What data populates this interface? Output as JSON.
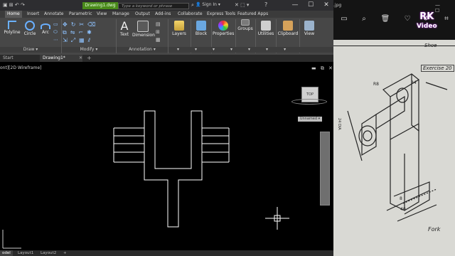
{
  "titlebar": {
    "file_title": "Drawing1.dwg",
    "search_placeholder": "Type a keyword or phrase",
    "sign_in": "Sign In",
    "help": "?",
    "minimize": "—",
    "maximize": "☐",
    "close": "✕"
  },
  "ribbon_tabs": [
    "Home",
    "Insert",
    "Annotate",
    "Parametric",
    "View",
    "Manage",
    "Output",
    "Add-ins",
    "Collaborate",
    "Express Tools",
    "Featured Apps"
  ],
  "ribbon": {
    "draw_tools": [
      "Polyline",
      "Circle",
      "Arc"
    ],
    "annotation_tools": [
      "Text",
      "Dimension"
    ],
    "big_tools": [
      "Layers",
      "Block",
      "Properties",
      "Groups",
      "Utilities",
      "Clipboard",
      "View"
    ],
    "panels": [
      "Draw",
      "Modify",
      "Annotation"
    ]
  },
  "file_tabs": [
    "Start",
    "Drawing1*"
  ],
  "viewport": {
    "label": "ont][2D Wireframe]",
    "viewcube_face": "TOP",
    "ucs_label": "Unnamed"
  },
  "layout_tabs": [
    "odel",
    "Layout1",
    "Layout2",
    "+"
  ],
  "viewer": {
    "filename_suffix": ".jpg",
    "watermark_line1": "RK",
    "watermark_line2": "Video",
    "photo_text": {
      "shoe": "Shoe",
      "exercise": "Exercise 20",
      "fork": "Fork",
      "dims": [
        "34",
        "R8",
        "24 DIA",
        "8",
        "40"
      ]
    }
  },
  "colors": {
    "title_green": "#4a8a1a",
    "ribbon_bg": "#474747",
    "canvas": "#000000",
    "geometry": "#ffffff"
  }
}
